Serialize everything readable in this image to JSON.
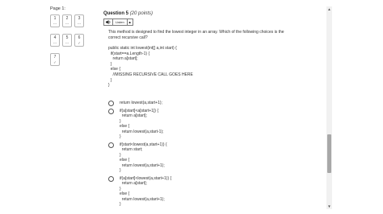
{
  "page": {
    "label": "Page 1:"
  },
  "nav": {
    "items": [
      {
        "num": "1",
        "mark": "---"
      },
      {
        "num": "2",
        "mark": "---"
      },
      {
        "num": "3",
        "mark": "---"
      },
      {
        "num": "4",
        "mark": "---"
      },
      {
        "num": "5",
        "mark": "---"
      },
      {
        "num": "6",
        "mark": "✓"
      },
      {
        "num": "7",
        "mark": "✓"
      }
    ]
  },
  "question": {
    "title": "Question 5",
    "points": "(20 points)",
    "listen_label": "Listen",
    "prompt": "This method is designed to find the lowest integer in an array.  Which of the following choices is the correct recursive call?",
    "code": [
      "public static int lowest(int[] a,int start) {",
      "  if(start==a.Length-1) {",
      "    return a[start];",
      "  }",
      "  else {",
      "    //MISSING RECURSIVE CALL GOES HERE",
      "  }",
      "}"
    ],
    "options": [
      {
        "lines": [
          "return lowest(a,start+1);"
        ]
      },
      {
        "lines": [
          "if(a[start]<a[start+1]) {",
          "  return a[start];",
          "}",
          "else {",
          "  return lowest(a,start-1);",
          "}"
        ]
      },
      {
        "lines": [
          "if(start<lowest(a,start+1)) {",
          "  return start;",
          "}",
          "else {",
          "  return lowest(a,start+1);",
          "}"
        ]
      },
      {
        "lines": [
          "if(a[start]<lowest(a,start+1)) {",
          "  return a[start];",
          "}",
          "else {",
          "  return lowest(a,start+1);",
          "}"
        ]
      }
    ]
  },
  "scrollbar": {
    "up_icon": "▲",
    "down_icon": "▼"
  }
}
